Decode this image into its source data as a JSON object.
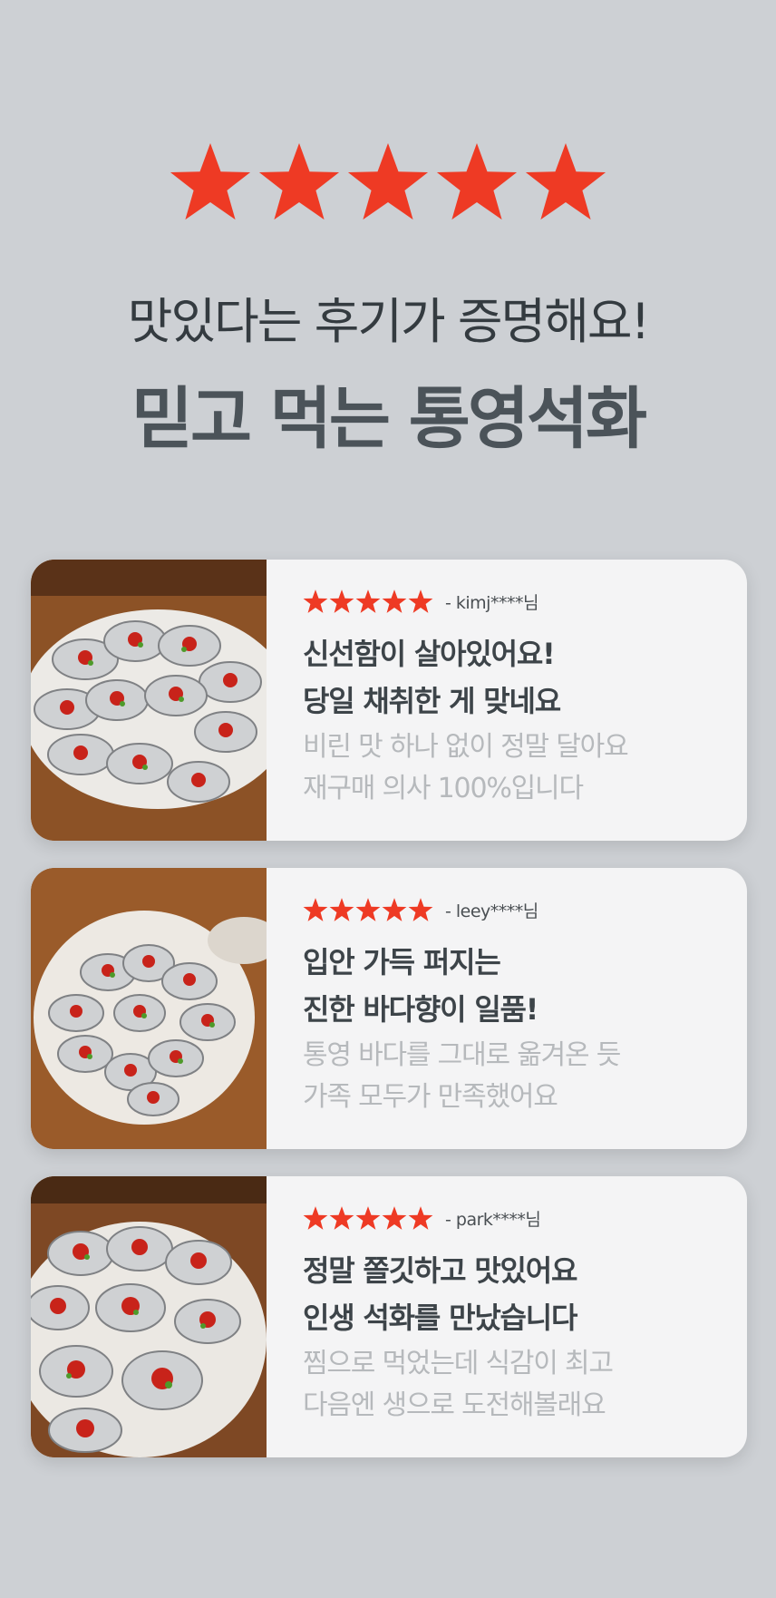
{
  "header": {
    "rating_stars": 5,
    "subtitle": "맛있다는 후기가 증명해요!",
    "title": "믿고 먹는 통영석화",
    "star_color": "#ee3a24"
  },
  "reviews": [
    {
      "stars": 5,
      "reviewer": "- kimj****님",
      "line1": "신선함이 살아있어요!",
      "line2": "당일 채취한 게 맞네요",
      "line3": "비린 맛 하나 없이 정말 달아요",
      "line4": "재구매 의사 100%입니다",
      "photo_icon": "oyster-platter-photo"
    },
    {
      "stars": 5,
      "reviewer": "- leey****님",
      "line1": "입안 가득 퍼지는",
      "line2": "진한 바다향이 일품!",
      "line3": "통영 바다를 그대로 옮겨온 듯",
      "line4": "가족 모두가 만족했어요",
      "photo_icon": "oyster-platter-photo"
    },
    {
      "stars": 5,
      "reviewer": "- park****님",
      "line1": "정말 쫄깃하고 맛있어요",
      "line2": "인생 석화를 만났습니다",
      "line3": "찜으로 먹었는데 식감이 최고",
      "line4": "다음엔 생으로 도전해볼래요",
      "photo_icon": "oyster-platter-photo"
    }
  ]
}
